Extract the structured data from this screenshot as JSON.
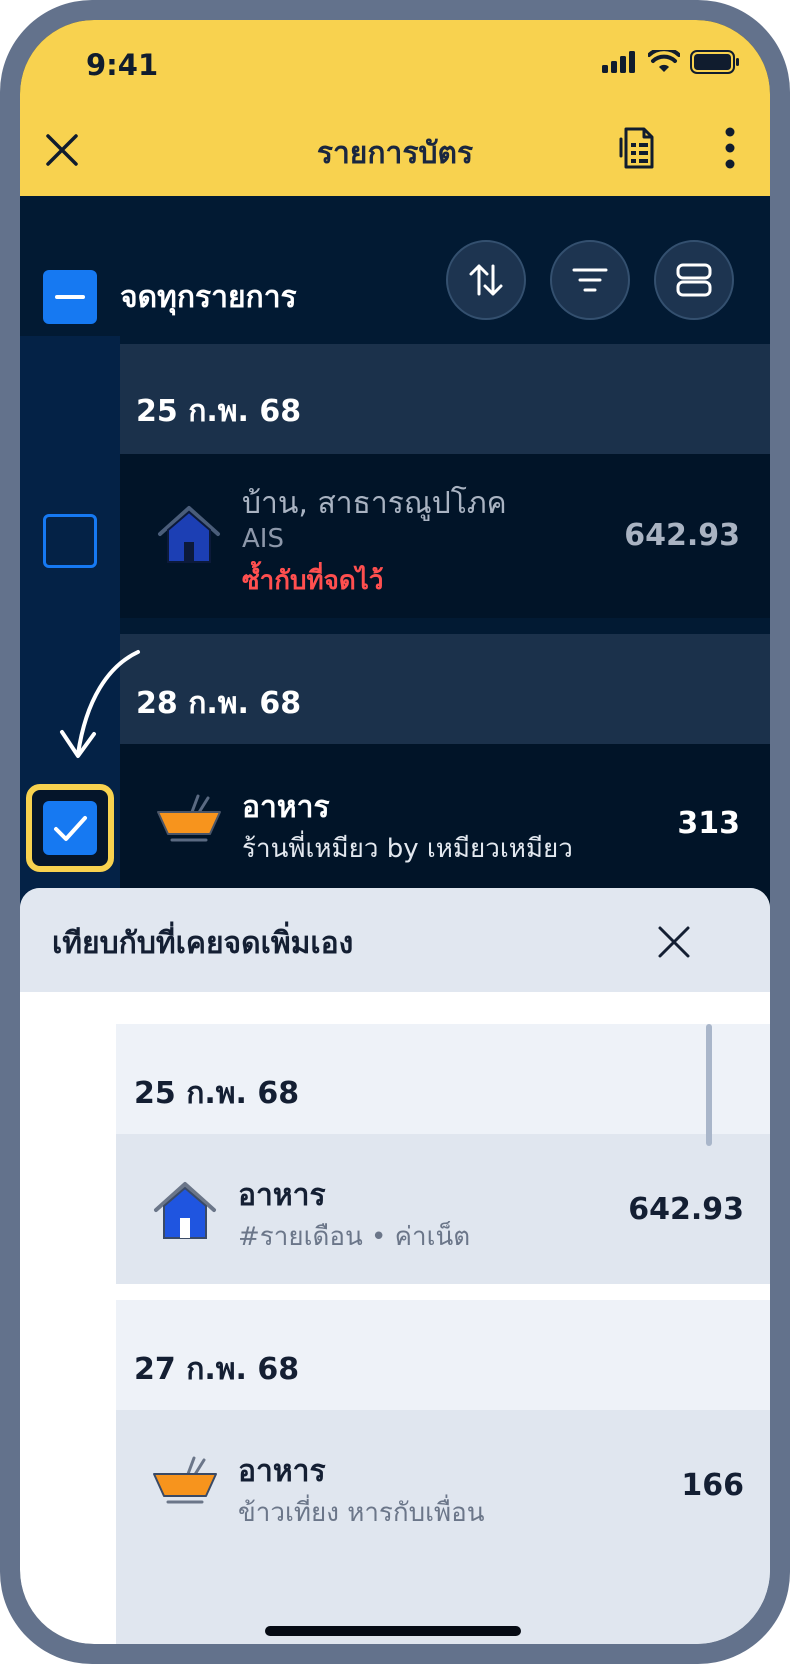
{
  "status_bar": {
    "time": "9:41"
  },
  "nav": {
    "title": "รายการบัตร"
  },
  "toolbar": {
    "select_all_label": "จดทุกรายการ"
  },
  "groups": [
    {
      "date": "25 ก.พ. 68",
      "item": {
        "category": "บ้าน, สาธารณูปโภค",
        "merchant": "AIS",
        "warning": "ซ้ำกับที่จดไว้",
        "amount": "642.93",
        "icon": "house-icon",
        "selected": false
      }
    },
    {
      "date": "28 ก.พ. 68",
      "item": {
        "category": "อาหาร",
        "merchant": "ร้านพี่เหมียว by เหมียวเหมียว",
        "amount": "313",
        "icon": "bowl-icon",
        "selected": true
      }
    }
  ],
  "sheet": {
    "title": "เทียบกับที่เคยจดเพิ่มเอง",
    "groups": [
      {
        "date": "25 ก.พ. 68",
        "item": {
          "category": "อาหาร",
          "note": "#รายเดือน • ค่าเน็ต",
          "amount": "642.93",
          "icon": "house-icon"
        }
      },
      {
        "date": "27 ก.พ. 68",
        "item": {
          "category": "อาหาร",
          "note": "ข้าวเที่ยง หารกับเพื่อน",
          "amount": "166",
          "icon": "bowl-icon"
        }
      }
    ]
  },
  "colors": {
    "header_yellow": "#f8d24f",
    "accent_blue": "#1679f2",
    "warning_red": "#ff4f4f",
    "dark_bg": "#021a33"
  }
}
